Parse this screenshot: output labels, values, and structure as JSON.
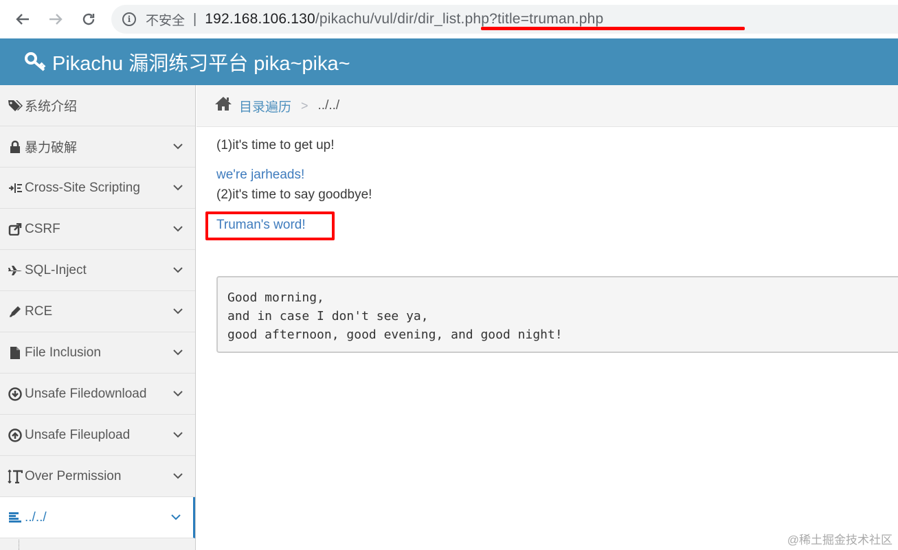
{
  "browser": {
    "security_label": "不安全",
    "separator": "|",
    "url_host": "192.168.106.130",
    "url_path": "/pikachu/vul/dir/dir_list.php?title=truman.php"
  },
  "header": {
    "title": "Pikachu 漏洞练习平台 pika~pika~"
  },
  "sidebar": {
    "items": [
      {
        "label": "系统介绍",
        "icon": "tags-icon"
      },
      {
        "label": "暴力破解",
        "icon": "lock-icon"
      },
      {
        "label": "Cross-Site Scripting",
        "icon": "indent-icon"
      },
      {
        "label": "CSRF",
        "icon": "share-icon"
      },
      {
        "label": "SQL-Inject",
        "icon": "plane-icon"
      },
      {
        "label": "RCE",
        "icon": "pencil-icon"
      },
      {
        "label": "File Inclusion",
        "icon": "file-icon"
      },
      {
        "label": "Unsafe Filedownload",
        "icon": "download-circle-icon"
      },
      {
        "label": "Unsafe Fileupload",
        "icon": "upload-circle-icon"
      },
      {
        "label": "Over Permission",
        "icon": "text-height-icon"
      },
      {
        "label": "../../",
        "icon": "align-left-icon"
      }
    ]
  },
  "breadcrumb": {
    "home_label": "目录遍历",
    "sep": ">",
    "current": "../../"
  },
  "content": {
    "line1": "(1)it's time to get up!",
    "link1": "we're jarheads!",
    "line2": "(2)it's time to say goodbye!",
    "link2": "Truman's word!",
    "quote": "Good morning,\nand in case I don't see ya,\ngood afternoon, good evening, and good night!"
  },
  "watermark": "@稀土掘金技术社区",
  "colors": {
    "header_bg": "#438eb9",
    "link": "#3e7bbd",
    "highlight": "#ff0000",
    "active": "#2b7dbc"
  }
}
